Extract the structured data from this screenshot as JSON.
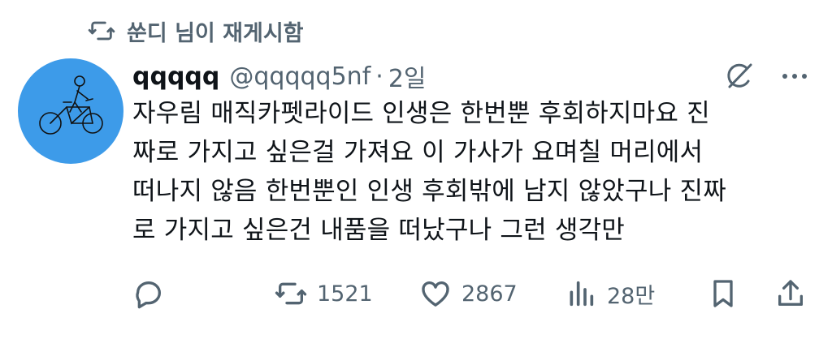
{
  "repost": {
    "text": "쑨디 님이 재게시함",
    "icon": "repost-icon"
  },
  "tweet": {
    "display_name": "qqqqq",
    "handle": "@qqqqq5nf",
    "separator": "·",
    "time": "2일",
    "lines": [
      "자우림 매직카펫라이드 인생은 한번뿐 후회하지마요 진",
      "짜로 가지고 싶은걸 가져요 이 가사가 요며칠 머리에서",
      "떠나지 않음 한번뿐인 인생 후회밖에 남지 않았구나 진짜",
      "로 가지고 싶은건 내품을 떠났구나 그런 생각만"
    ]
  },
  "actions": {
    "reply": {
      "icon": "reply-icon",
      "count": ""
    },
    "repost": {
      "icon": "repost-icon",
      "count": "1521"
    },
    "like": {
      "icon": "heart-icon",
      "count": "2867"
    },
    "views": {
      "icon": "views-icon",
      "count": "28만"
    },
    "bookmark": {
      "icon": "bookmark-icon",
      "count": ""
    },
    "share": {
      "icon": "share-icon",
      "count": ""
    }
  },
  "colors": {
    "text": "#0f1419",
    "secondary": "#536471",
    "avatar_bg": "#3d9be9"
  }
}
